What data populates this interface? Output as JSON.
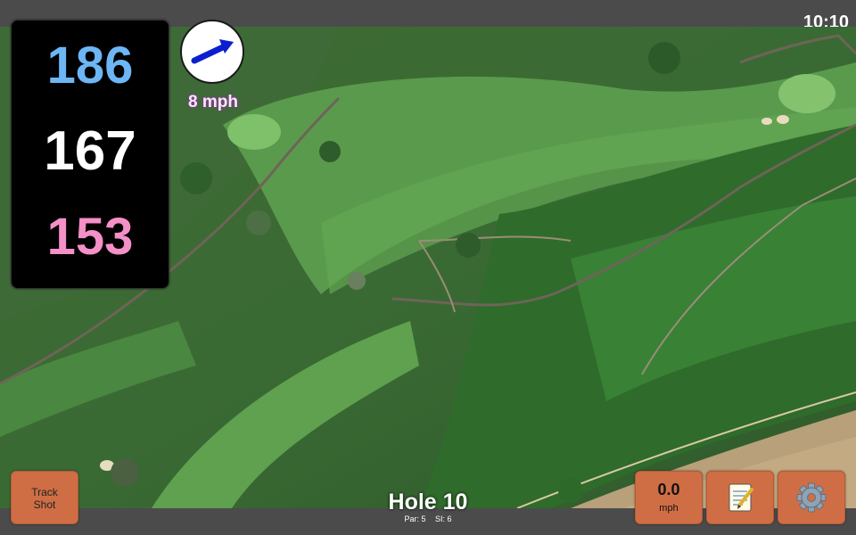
{
  "status": {
    "clock": "10:10"
  },
  "distances": {
    "back": "186",
    "middle": "167",
    "front": "153"
  },
  "wind": {
    "speed": "8 mph",
    "icon": "wind-direction-arrow-icon"
  },
  "buttons": {
    "track_shot_line1": "Track",
    "track_shot_line2": "Shot",
    "speed_value": "0.0",
    "speed_unit": "mph",
    "notes_icon": "notepad-icon",
    "settings_icon": "gear-icon"
  },
  "hole": {
    "title": "Hole 10",
    "par": "Par: 5",
    "si": "SI: 6"
  },
  "colors": {
    "back": "#6db6f5",
    "middle": "#ffffff",
    "front": "#f48fc7",
    "button": "#cf6e45"
  }
}
